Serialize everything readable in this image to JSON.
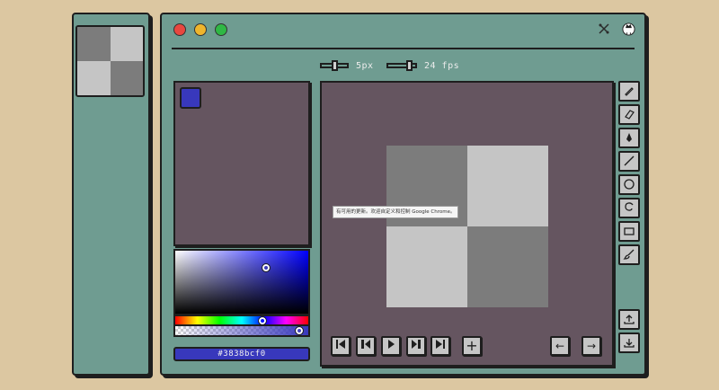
{
  "frames": {
    "thumbnail_cells": [
      "#7c7c7c",
      "#c5c5c5",
      "#c5c5c5",
      "#7c7c7c"
    ]
  },
  "window": {
    "traffic_lights": {
      "close": "#e8473f",
      "minimize": "#efb52c",
      "maximize": "#2fb845"
    },
    "brush_size_label": "5px",
    "fps_label": "24 fps",
    "brush_size_fraction": 0.5,
    "fps_fraction": 0.85
  },
  "palette": {
    "selected_color": "#3838bc"
  },
  "color_picker": {
    "hex_value": "#3838bcf0"
  },
  "canvas": {
    "cells": [
      "#7c7c7c",
      "#c5c5c5",
      "#c5c5c5",
      "#7c7c7c"
    ],
    "tooltip_text": "有可用的更新。欢迎自定义和控制 Google Chrome。"
  },
  "playback": {
    "first": "⏮",
    "prev": "⏪",
    "play": "▶",
    "next": "⏩",
    "last": "⏭",
    "add": "+",
    "undo": "←",
    "redo": "→"
  },
  "tools": [
    "pencil-icon",
    "eraser-icon",
    "fill-icon",
    "line-icon",
    "circle-icon",
    "lasso-icon",
    "rectangle-icon",
    "brush-icon"
  ],
  "actions": [
    "import-icon",
    "export-icon"
  ]
}
